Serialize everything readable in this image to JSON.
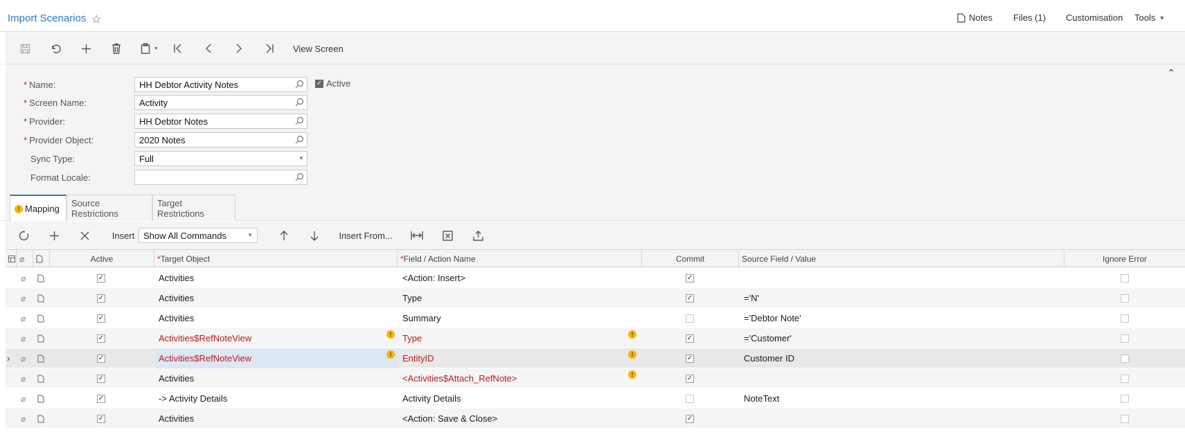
{
  "header": {
    "title": "Import Scenarios",
    "notes": "Notes",
    "files": "Files (1)",
    "customisation": "Customisation",
    "tools": "Tools"
  },
  "toolbar": {
    "view_screen": "View Screen"
  },
  "form": {
    "name_label": "Name:",
    "name_value": "HH Debtor Activity Notes",
    "active_label": "Active",
    "active_checked": true,
    "screen_name_label": "Screen Name:",
    "screen_name_value": "Activity",
    "provider_label": "Provider:",
    "provider_value": "HH Debtor Notes",
    "provider_object_label": "Provider Object:",
    "provider_object_value": "2020 Notes",
    "sync_type_label": "Sync Type:",
    "sync_type_value": "Full",
    "format_locale_label": "Format Locale:",
    "format_locale_value": ""
  },
  "tabs": [
    {
      "label": "Mapping",
      "active": true
    },
    {
      "label": "Source Restrictions",
      "active": false
    },
    {
      "label": "Target Restrictions",
      "active": false
    }
  ],
  "grid_toolbar": {
    "insert": "Insert",
    "show_select": "Show All Commands",
    "insert_from": "Insert From..."
  },
  "grid": {
    "columns": {
      "active": "Active",
      "target_object": "Target Object",
      "field_action": "Field / Action Name",
      "commit": "Commit",
      "source_field": "Source Field / Value",
      "ignore_error": "Ignore Error"
    },
    "rows": [
      {
        "active": true,
        "target": "Activities",
        "target_warn": false,
        "field": "<Action: Insert>",
        "field_warn": false,
        "commit": true,
        "source": "",
        "ignore": false
      },
      {
        "active": true,
        "target": "Activities",
        "target_warn": false,
        "field": "Type",
        "field_warn": false,
        "commit": true,
        "source": "='N'",
        "ignore": false
      },
      {
        "active": true,
        "target": "Activities",
        "target_warn": false,
        "field": "Summary",
        "field_warn": false,
        "commit": false,
        "source": "='Debtor Note'",
        "ignore": false
      },
      {
        "active": true,
        "target": "Activities$RefNoteView",
        "target_warn": true,
        "field": "Type",
        "field_warn": true,
        "commit": true,
        "source": "='Customer'",
        "ignore": false
      },
      {
        "active": true,
        "target": "Activities$RefNoteView",
        "target_warn": true,
        "field": "EntityID",
        "field_warn": true,
        "commit": true,
        "source": "Customer ID",
        "ignore": false
      },
      {
        "active": true,
        "target": "Activities",
        "target_warn": false,
        "field": "<Activities$Attach_RefNote>",
        "field_warn": true,
        "commit": true,
        "source": "",
        "ignore": false
      },
      {
        "active": true,
        "target": "-> Activity Details",
        "target_warn": false,
        "field": "Activity Details",
        "field_warn": false,
        "commit": false,
        "source": "NoteText",
        "ignore": false
      },
      {
        "active": true,
        "target": "Activities",
        "target_warn": false,
        "field": "<Action: Save & Close>",
        "field_warn": false,
        "commit": true,
        "source": "",
        "ignore": false
      }
    ]
  },
  "colors": {
    "accent": "#2b7bc1",
    "error": "#b71c1c",
    "warning": "#f5b800"
  }
}
